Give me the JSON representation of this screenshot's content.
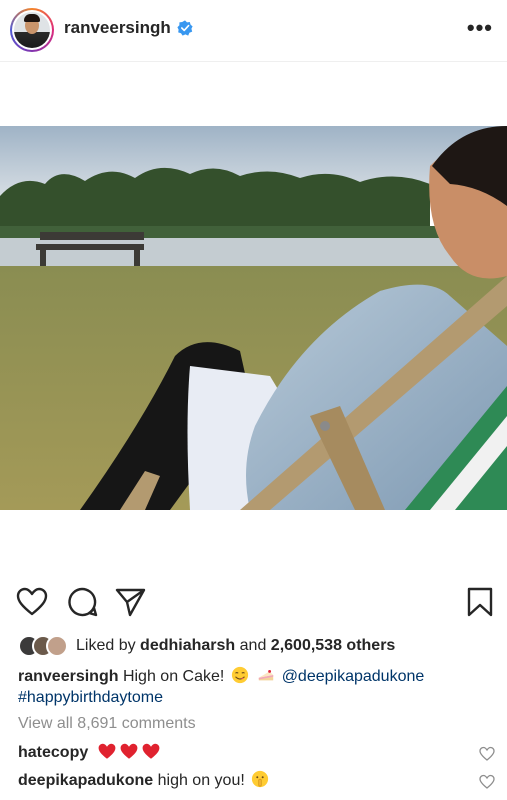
{
  "header": {
    "username": "ranveersingh",
    "verified_icon": "verified-badge-icon",
    "more_icon": "more-options-icon",
    "more_label": "•••"
  },
  "post": {
    "image_description_icon": "post-photo"
  },
  "actions": {
    "like_icon": "heart-icon",
    "comment_icon": "comment-icon",
    "share_icon": "paper-plane-icon",
    "save_icon": "bookmark-icon"
  },
  "likes": {
    "prefix": "Liked by",
    "user": "dedhiaharsh",
    "and": "and",
    "count": "2,600,538 others"
  },
  "caption": {
    "username": "ranveersingh",
    "text": "High on Cake!",
    "mention": "@deepikapadukone",
    "hashtag": "#happybirthdaytome"
  },
  "comments_summary": "View all 8,691 comments",
  "comments": [
    {
      "username": "hatecopy",
      "text": ""
    },
    {
      "username": "deepikapadukone",
      "text": "high on you!"
    }
  ],
  "colors": {
    "link": "#003569",
    "verified": "#3897f0",
    "heart_red": "#ed4956",
    "muted": "#8e8e8e"
  }
}
